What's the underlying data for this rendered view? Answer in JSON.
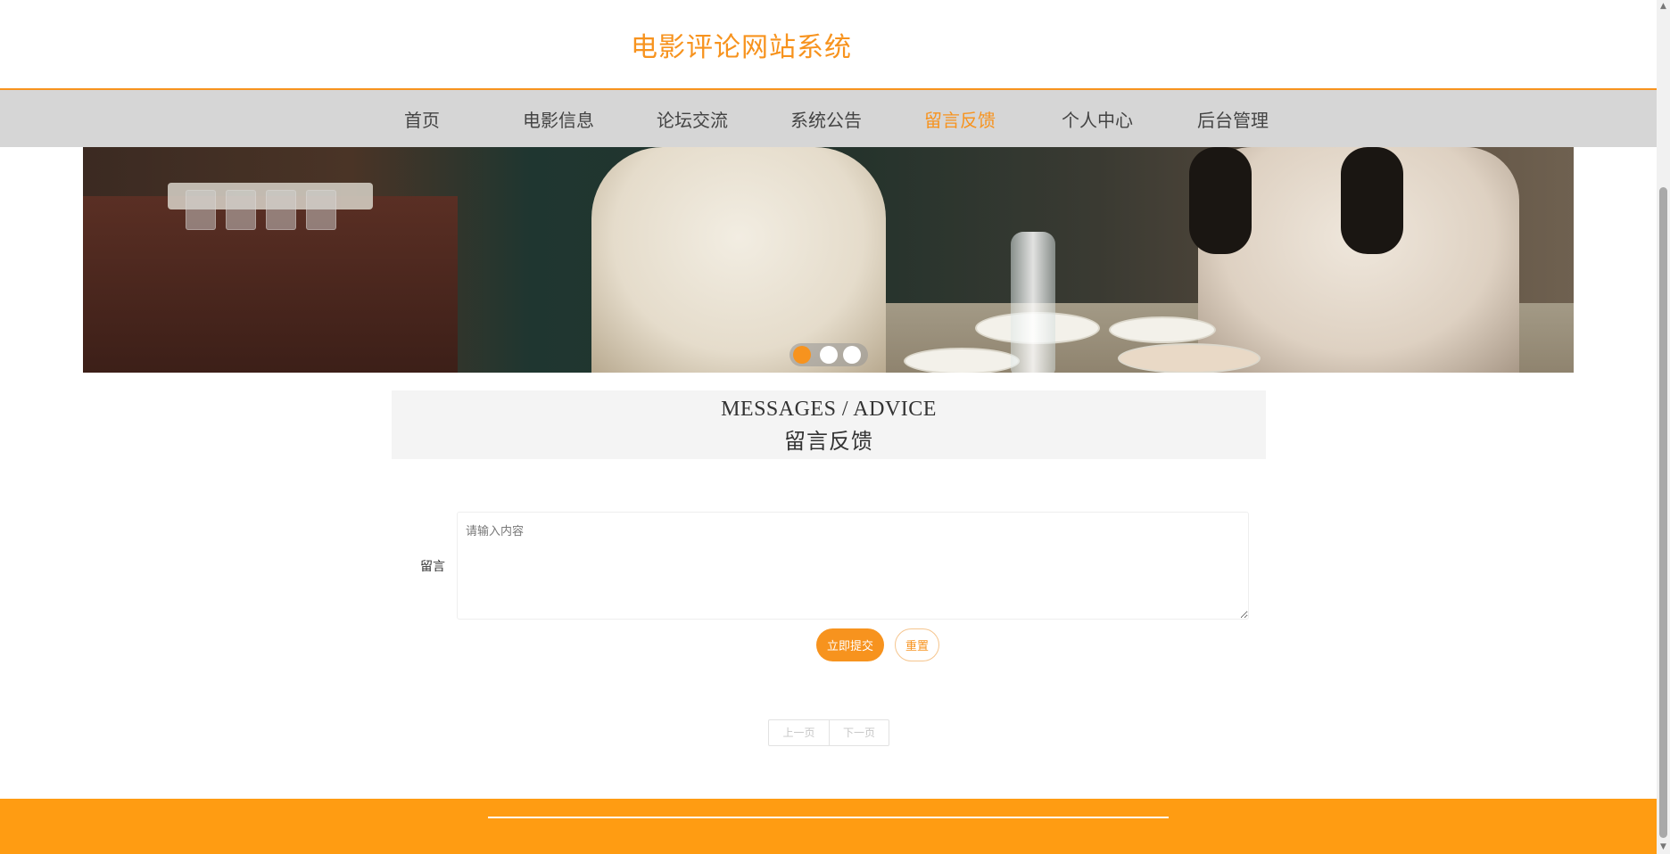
{
  "header": {
    "site_title": "电影评论网站系统"
  },
  "nav": {
    "items": [
      {
        "label": "首页"
      },
      {
        "label": "电影信息"
      },
      {
        "label": "论坛交流"
      },
      {
        "label": "系统公告"
      },
      {
        "label": "留言反馈",
        "active": true
      },
      {
        "label": "个人中心"
      },
      {
        "label": "后台管理"
      }
    ]
  },
  "carousel": {
    "slide_count": 3,
    "active_index": 0
  },
  "section": {
    "title_en": "MESSAGES / ADVICE",
    "title_cn": "留言反馈"
  },
  "form": {
    "message_label": "留言",
    "message_value": "",
    "message_placeholder": "请输入内容",
    "submit_label": "立即提交",
    "reset_label": "重置"
  },
  "pagination": {
    "prev_label": "上一页",
    "next_label": "下一页"
  },
  "colors": {
    "accent": "#f7931e",
    "footer": "#ff9c12",
    "nav_bg": "#d6d6d6"
  }
}
